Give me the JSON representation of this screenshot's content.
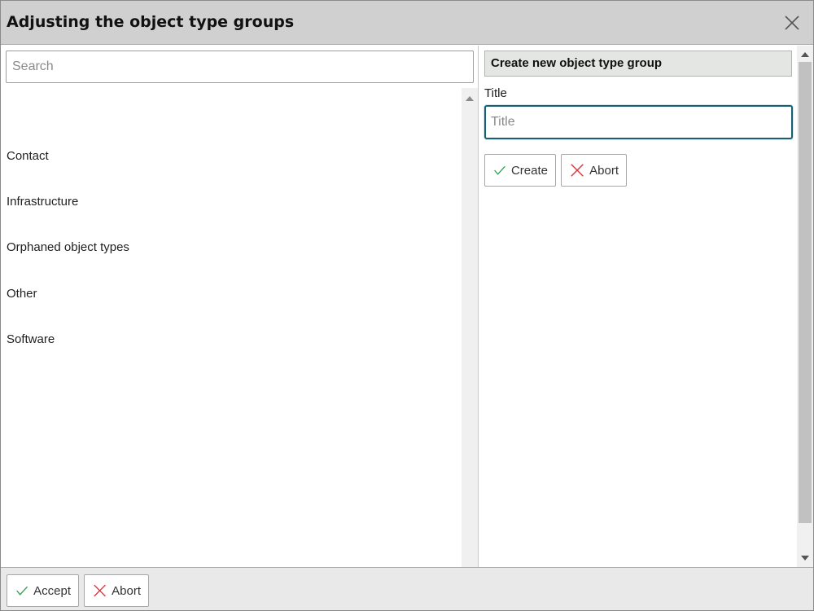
{
  "dialog": {
    "title": "Adjusting the object type groups",
    "close_icon": "close-icon"
  },
  "search": {
    "placeholder": "Search",
    "value": ""
  },
  "groups": {
    "items": [
      {
        "label": "Contact"
      },
      {
        "label": "Infrastructure"
      },
      {
        "label": "Orphaned object types"
      },
      {
        "label": "Other"
      },
      {
        "label": "Software"
      }
    ]
  },
  "create_panel": {
    "header": "Create new object type group",
    "title_label": "Title",
    "title_placeholder": "Title",
    "title_value": "",
    "create_label": "Create",
    "abort_label": "Abort"
  },
  "footer": {
    "accept_label": "Accept",
    "abort_label": "Abort"
  },
  "colors": {
    "titlebar_bg": "#cfd0cf",
    "focus_border": "#1b5f73",
    "check_green": "#2e9e4f",
    "cross_red": "#d9363e",
    "footer_bg": "#e9e9e9"
  }
}
